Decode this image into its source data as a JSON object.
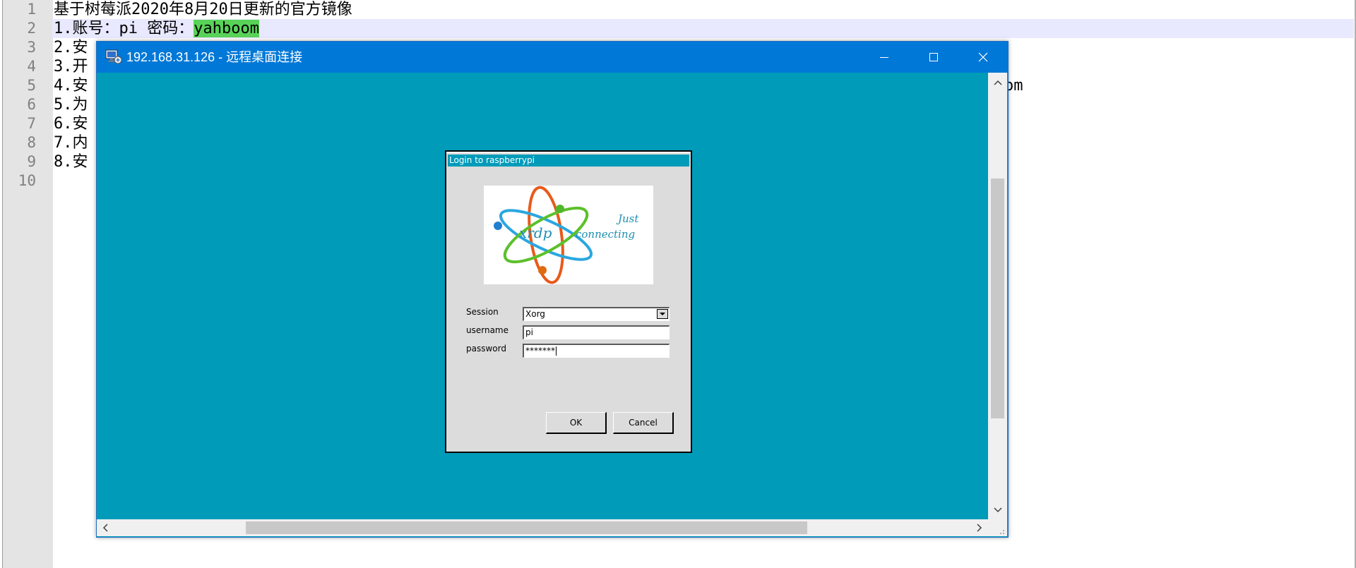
{
  "editor": {
    "lines": [
      {
        "no": "1",
        "text": "基于树莓派2020年8月20日更新的官方镜像"
      },
      {
        "no": "2",
        "text": "1.账号：pi 密码：",
        "highlight": "yahboom"
      },
      {
        "no": "3",
        "text": "2.安"
      },
      {
        "no": "4",
        "text": "3.开"
      },
      {
        "no": "5",
        "text": "4.安"
      },
      {
        "no": "6",
        "text": "5.为"
      },
      {
        "no": "7",
        "text": "6.安"
      },
      {
        "no": "8",
        "text": "7.内"
      },
      {
        "no": "9",
        "text": "8.安"
      },
      {
        "no": "10",
        "text": ""
      }
    ],
    "right_fragment": "om"
  },
  "rdp_window": {
    "title": "192.168.31.126 - 远程桌面连接",
    "icons": {
      "app": "remote-desktop-icon",
      "minimize": "minimize-icon",
      "maximize": "maximize-icon",
      "close": "close-icon"
    },
    "background_color": "#009bb9",
    "titlebar_color": "#0078d7"
  },
  "login_dialog": {
    "title": "Login to raspberrypi",
    "logo": {
      "brand": "xrdp",
      "tagline_1": "Just",
      "tagline_2": "connecting"
    },
    "session_label": "Session",
    "session_value": "Xorg",
    "username_label": "username",
    "username_value": "pi",
    "password_label": "password",
    "password_value": "*******",
    "ok_label": "OK",
    "cancel_label": "Cancel"
  }
}
